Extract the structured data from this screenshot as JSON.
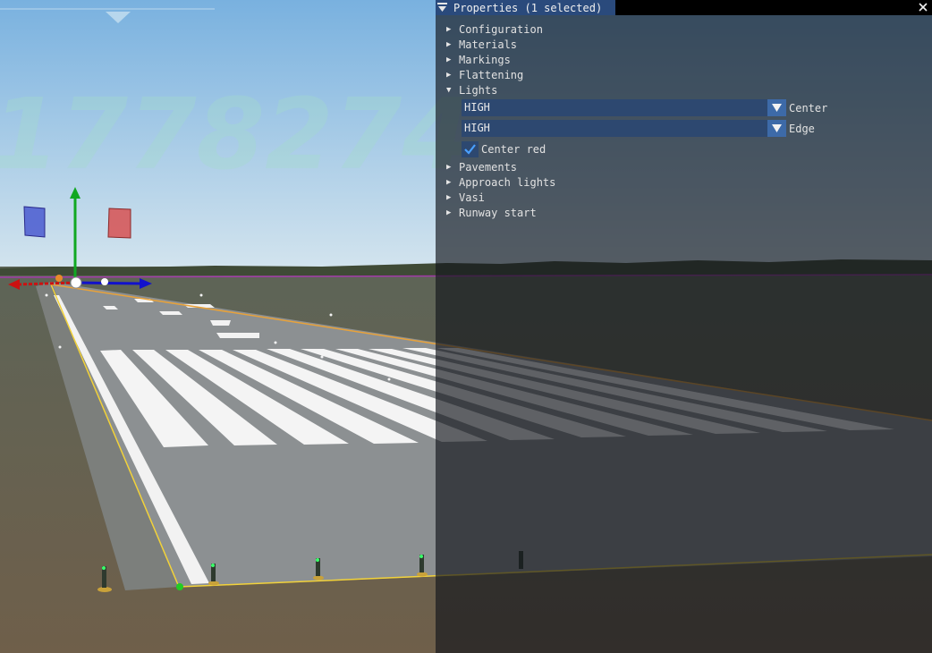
{
  "window": {
    "title": "Properties (1 selected)",
    "collapse_icon": "triangle-down-icon",
    "close_icon": "close-icon"
  },
  "tree": {
    "configuration": "Configuration",
    "materials": "Materials",
    "markings": "Markings",
    "flattening": "Flattening",
    "lights": "Lights",
    "pavements": "Pavements",
    "approach_lights": "Approach lights",
    "vasi": "Vasi",
    "runway_start": "Runway start"
  },
  "lights": {
    "center": {
      "value": "HIGH",
      "label": "Center"
    },
    "edge": {
      "value": "HIGH",
      "label": "Edge"
    },
    "center_red": {
      "label": "Center red",
      "checked": true
    }
  },
  "scene": {
    "watermark": "1778274",
    "colors": {
      "sky_top": "#7cb3df",
      "sky_horizon": "#cfe2ef",
      "pavement": "#8b9091",
      "panel_accent": "#2a4a7c",
      "axis_x": "#cc1111",
      "axis_y": "#11a822",
      "axis_z": "#1111cc"
    }
  }
}
